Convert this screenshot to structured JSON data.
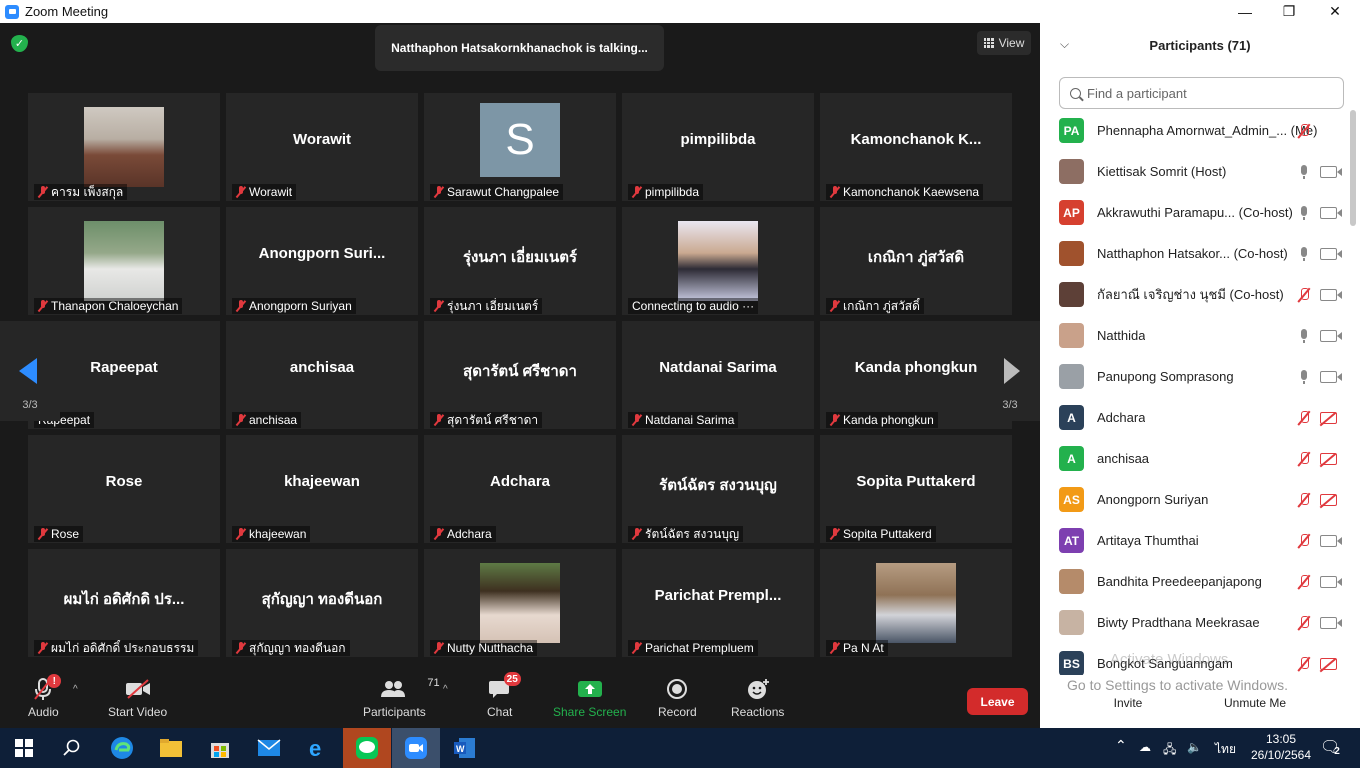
{
  "window": {
    "title": "Zoom Meeting",
    "minimize": "—",
    "maximize": "❐",
    "close": "✕"
  },
  "meeting": {
    "talking": "Natthaphon Hatsakornkhanachok is talking...",
    "view_label": "View",
    "page_indicator_left": "3/3",
    "page_indicator_right": "3/3"
  },
  "tiles": [
    {
      "big": "",
      "label": "คารม เพ็งสกุล",
      "photo": "person",
      "muted": true
    },
    {
      "big": "Worawit",
      "label": "Worawit",
      "muted": true
    },
    {
      "big": "",
      "label": "Sarawut Changpalee",
      "photo": "letter",
      "letter": "S",
      "muted": true
    },
    {
      "big": "pimpilibda",
      "label": "pimpilibda",
      "muted": true
    },
    {
      "big": "Kamonchanok  K...",
      "label": "Kamonchanok Kaewsena",
      "muted": true
    },
    {
      "big": "",
      "label": "Thanapon Chaloeychan",
      "photo": "person2",
      "muted": true
    },
    {
      "big": "Anongporn  Suri...",
      "label": "Anongporn Suriyan",
      "muted": true
    },
    {
      "big": "รุ่งนภา เอี่ยมเนตร์",
      "label": "รุ่งนภา เอี่ยมเนตร์",
      "muted": true
    },
    {
      "big": "",
      "label": "Connecting to audio ···",
      "photo": "person3",
      "muted": false
    },
    {
      "big": "เกณิกา ภู่สวัสดิ",
      "label": "เกณิกา ภู่สวัสดิ์",
      "muted": true
    },
    {
      "big": "Rapeepat",
      "label": "Rapeepat",
      "muted": false
    },
    {
      "big": "anchisaa",
      "label": "anchisaa",
      "muted": true
    },
    {
      "big": "สุดารัตน์ ศรีชาดา",
      "label": "สุดารัตน์ ศรีชาดา",
      "muted": true
    },
    {
      "big": "Natdanai Sarima",
      "label": "Natdanai Sarima",
      "muted": true
    },
    {
      "big": "Kanda phongkun",
      "label": "Kanda phongkun",
      "muted": true
    },
    {
      "big": "Rose",
      "label": "Rose",
      "muted": true
    },
    {
      "big": "khajeewan",
      "label": "khajeewan",
      "muted": true
    },
    {
      "big": "Adchara",
      "label": "Adchara",
      "muted": true
    },
    {
      "big": "รัตน์ฉัตร สงวนบุญ",
      "label": "รัตน์ฉัตร สงวนบุญ",
      "muted": true
    },
    {
      "big": "Sopita Puttakerd",
      "label": "Sopita Puttakerd",
      "muted": true
    },
    {
      "big": "ผมไก่ อดิศักดิ ปร...",
      "label": "ผมไก่ อดิศักดิ์ ประกอบธรรม",
      "muted": true
    },
    {
      "big": "สุกัญญา ทองดีนอก",
      "label": "สุกัญญา ทองดีนอก",
      "muted": true
    },
    {
      "big": "",
      "label": "Nutty Nutthacha",
      "photo": "person4",
      "muted": true
    },
    {
      "big": "Parichat  Prempl...",
      "label": "Parichat Prempluem",
      "muted": true
    },
    {
      "big": "",
      "label": "Pa N At",
      "photo": "room",
      "muted": true
    }
  ],
  "toolbar": {
    "audio": "Audio",
    "audio_alert": "!",
    "start_video": "Start Video",
    "participants": "Participants",
    "participants_count": "71",
    "chat": "Chat",
    "chat_badge": "25",
    "share_screen": "Share Screen",
    "record": "Record",
    "reactions": "Reactions",
    "leave": "Leave"
  },
  "panel": {
    "title": "Participants (71)",
    "search_placeholder": "Find a participant",
    "invite": "Invite",
    "unmute_me": "Unmute Me",
    "watermark_title": "Activate Windows",
    "watermark_sub": "Go to Settings to activate Windows.",
    "participants": [
      {
        "initials": "PA",
        "color": "#23b14d",
        "name": "Phennapha Amornwat_Admin_...   (Me)",
        "mic": "red",
        "cam": "none"
      },
      {
        "initials": "",
        "color": "#8d6e63",
        "name": "Kiettisak Somrit (Host)",
        "mic": "on",
        "cam": "on"
      },
      {
        "initials": "AP",
        "color": "#d6402f",
        "name": "Akkrawuthi Paramapu...  (Co-host)",
        "mic": "on",
        "cam": "on"
      },
      {
        "initials": "",
        "color": "#a0522d",
        "name": "Natthaphon Hatsakor...  (Co-host)",
        "mic": "on",
        "cam": "on"
      },
      {
        "initials": "",
        "color": "#5d4037",
        "name": "กัลยาณี เจริญช่าง นุชมี (Co-host)",
        "mic": "red",
        "cam": "on"
      },
      {
        "initials": "",
        "color": "#c9a18a",
        "name": "Natthida",
        "mic": "on",
        "cam": "on"
      },
      {
        "initials": "",
        "color": "#9aa0a6",
        "name": "Panupong Somprasong",
        "mic": "on",
        "cam": "on"
      },
      {
        "initials": "A",
        "color": "#2b4159",
        "name": "Adchara",
        "mic": "red",
        "cam": "red"
      },
      {
        "initials": "A",
        "color": "#23b14d",
        "name": "anchisaa",
        "mic": "red",
        "cam": "red"
      },
      {
        "initials": "AS",
        "color": "#f29a16",
        "name": "Anongporn Suriyan",
        "mic": "red",
        "cam": "red"
      },
      {
        "initials": "AT",
        "color": "#7d3fb0",
        "name": "Artitaya Thumthai",
        "mic": "red",
        "cam": "on"
      },
      {
        "initials": "",
        "color": "#b58b6a",
        "name": "Bandhita Preedeepanjapong",
        "mic": "red",
        "cam": "on"
      },
      {
        "initials": "",
        "color": "#c7b3a3",
        "name": "Biwty Pradthana Meekrasae",
        "mic": "red",
        "cam": "on"
      },
      {
        "initials": "BS",
        "color": "#2b4159",
        "name": "Bongkot Sanguanngam",
        "mic": "red",
        "cam": "red"
      }
    ]
  },
  "taskbar": {
    "lang": "ไทย",
    "time": "13:05",
    "date": "26/10/2564",
    "notif": "2"
  }
}
